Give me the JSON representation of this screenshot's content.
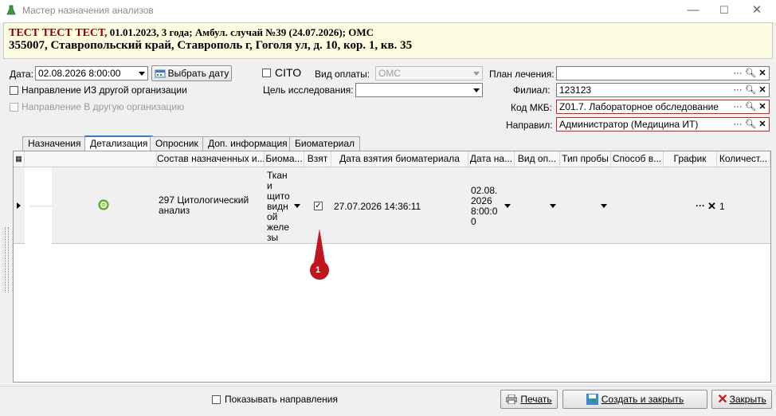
{
  "window": {
    "title": "Мастер назначения анализов",
    "minimize": "—",
    "maximize": "☐",
    "close": "✕"
  },
  "patient": {
    "name": "ТЕСТ ТЕСТ ТЕСТ,",
    "info": " 01.01.2023, 3 года; Амбул. случай №39 (24.07.2026); ОМС",
    "address": "355007, Ставропольский край, Ставрополь г, Гоголя ул, д. 10, кор. 1, кв. 35"
  },
  "form": {
    "date_label": "Дата:",
    "date_value": "02.08.2026 8:00:00",
    "choose_date_button": "Выбрать дату",
    "cito_label": "CITO",
    "payment_label": "Вид оплаты:",
    "payment_value": "ОМС",
    "treatment_plan_label": "План лечения:",
    "treatment_plan_value": "",
    "direction_from_label": "Направление ИЗ другой организации",
    "direction_to_label": "Направление В другую организацию",
    "research_goal_label": "Цель исследования:",
    "research_goal_value": "",
    "branch_label": "Филиал:",
    "branch_value": "123123",
    "mkb_label": "Код МКБ:",
    "mkb_value": "Z01.7. Лабораторное обследование",
    "directed_by_label": "Направил:",
    "directed_by_value": "Администратор (Медицина ИТ)"
  },
  "tabs": [
    {
      "label": "Назначения"
    },
    {
      "label": "Детализация"
    },
    {
      "label": "Опросник"
    },
    {
      "label": "Доп. информация"
    },
    {
      "label": "Биоматериал"
    }
  ],
  "grid": {
    "columns": [
      "Состав назначенных и...",
      "Биома...",
      "Взят",
      "Дата взятия биоматериала",
      "Дата на...",
      "Вид оп...",
      "Тип пробы",
      "Способ в...",
      "График",
      "Количест..."
    ],
    "row": {
      "dash": "————",
      "composition": "297 Цитологический анализ",
      "biomaterial_lines": [
        "Ткан",
        "и",
        "щито",
        "видн",
        "ой",
        "желе",
        "зы"
      ],
      "taken": true,
      "taken_date": "27.07.2026 14:36:11",
      "date_na_lines": [
        "02.08.",
        "2026",
        "8:00:0",
        "0"
      ],
      "schedule": "···",
      "quantity": "1"
    }
  },
  "annotation": {
    "marker": "1",
    "color": "#c0141e"
  },
  "footer": {
    "show_directions_label": "Показывать направления",
    "print_button": "Печать",
    "create_close_button": "Создать и закрыть",
    "close_button": "Закрыть"
  }
}
